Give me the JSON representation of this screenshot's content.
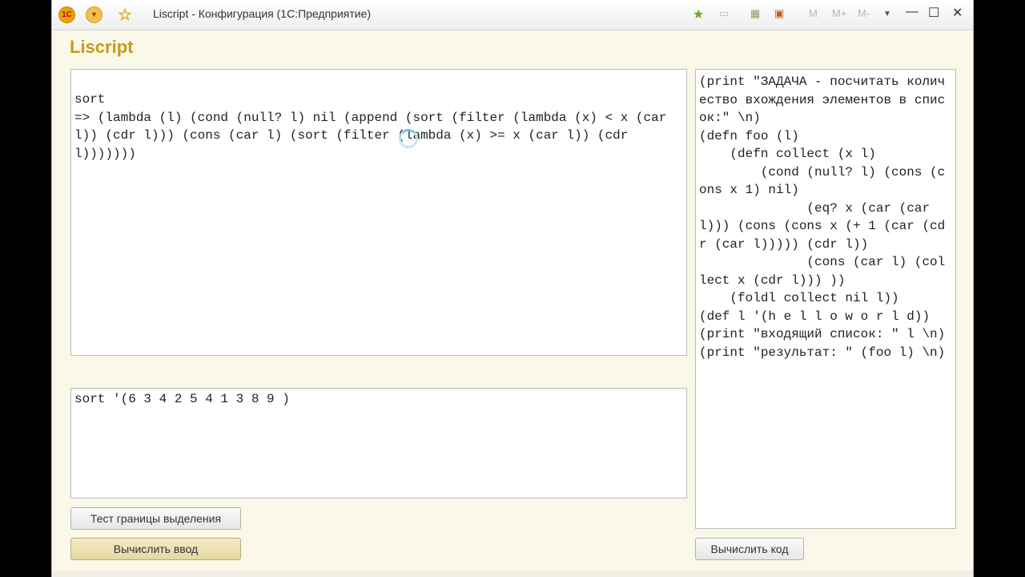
{
  "window": {
    "title": "Liscript - Конфигурация  (1С:Предприятие)",
    "toolbar": {
      "m_label": "M",
      "m_plus_label": "M+",
      "m_minus_label": "M-"
    }
  },
  "form": {
    "title": "Liscript"
  },
  "result_panel": {
    "text": "sort\n=> (lambda (l) (cond (null? l) nil (append (sort (filter (lambda (x) < x (car l)) (cdr l))) (cons (car l) (sort (filter (lambda (x) >= x (car l)) (cdr l)))))))"
  },
  "input_panel": {
    "text": "sort '(6 3 4 2 5 4 1 3 8 9 )"
  },
  "code_panel": {
    "text": "(print \"ЗАДАЧА - посчитать количество вхождения элементов в список:\" \\n)\n(defn foo (l)\n    (defn collect (x l)\n        (cond (null? l) (cons (cons x 1) nil)\n              (eq? x (car (car l))) (cons (cons x (+ 1 (car (cdr (car l))))) (cdr l))\n              (cons (car l) (collect x (cdr l))) ))\n    (foldl collect nil l))\n(def l '(h e l l o w o r l d))\n(print \"входящий список: \" l \\n)\n(print \"результат: \" (foo l) \\n)"
  },
  "buttons": {
    "test_selection": "Тест границы выделения",
    "eval_input": "Вычислить ввод",
    "eval_code": "Вычислить код"
  }
}
